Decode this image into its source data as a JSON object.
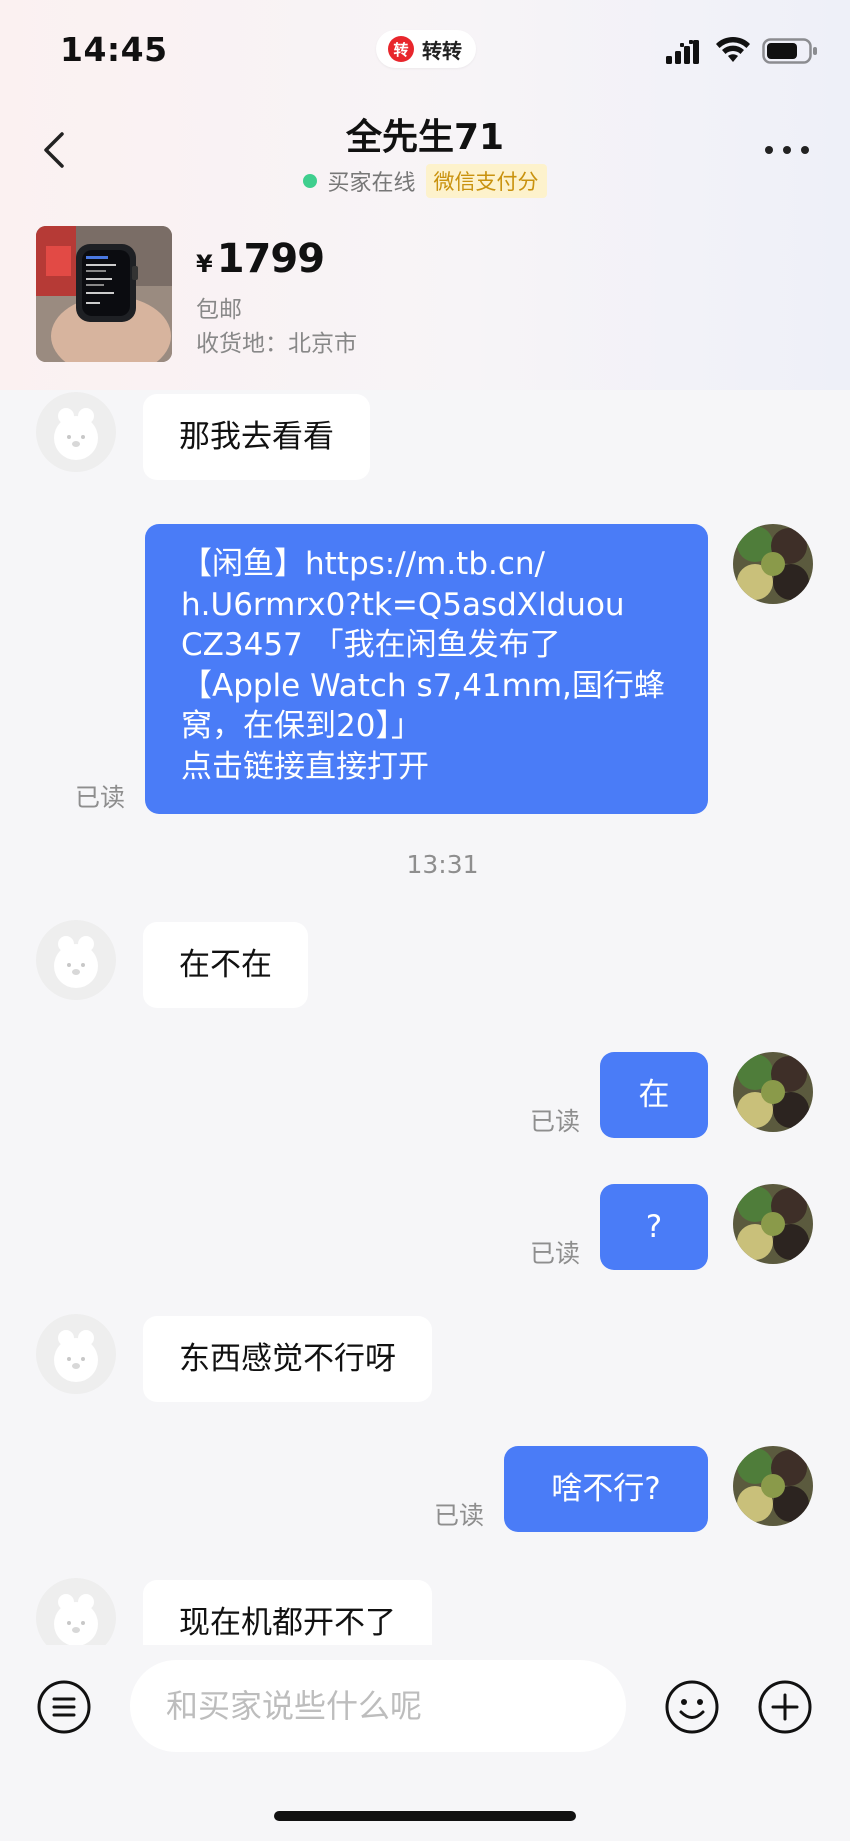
{
  "status_bar": {
    "time": "14:45",
    "app_logo_glyph": "转",
    "app_name": "转转",
    "signal_icon": "cellular-signal-icon",
    "wifi_icon": "wifi-icon",
    "battery_icon": "battery-icon",
    "battery_level": 0.75
  },
  "header": {
    "title": "全先生71",
    "status_text": "买家在线",
    "badge": "微信支付分",
    "online_color": "#3fcf8e"
  },
  "product": {
    "currency": "¥",
    "price": "1799",
    "shipping": "包邮",
    "location": "收货地：北京市"
  },
  "messages": {
    "m1": "那我去看看",
    "m2_lines": [
      "【闲鱼】https://m.tb.cn/",
      "h.U6rmrx0?tk=Q5asdXlduou",
      "CZ3457 「我在闲鱼发布了",
      "【Apple Watch s7,41mm,国行蜂",
      "窝，在保到20】」",
      "点击链接直接打开"
    ],
    "m2_read": "已读",
    "timestamp": "13:31",
    "m3": "在不在",
    "m4": "在",
    "m4_read": "已读",
    "m5": "?",
    "m5_read": "已读",
    "m6": "东西感觉不行呀",
    "m7": "啥不行?",
    "m7_read": "已读",
    "m8": "现在机都开不了"
  },
  "input": {
    "placeholder": "和买家说些什么呢"
  },
  "colors": {
    "accent": "#4a7cf7",
    "badge_text": "#c9920e",
    "badge_bg": "#fdf2cc",
    "logo_red": "#e8262c"
  },
  "icons": {
    "back": "chevron-left-icon",
    "more": "more-dots-icon",
    "menu": "menu-icon",
    "emoji": "emoji-icon",
    "plus": "plus-icon"
  }
}
